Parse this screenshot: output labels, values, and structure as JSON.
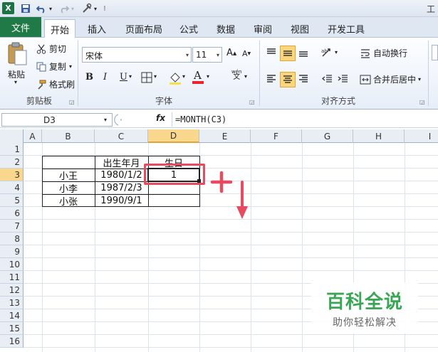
{
  "titlebar": {
    "app_icon_letter": "X",
    "title_fragment": "工"
  },
  "tabs": {
    "file": "文件",
    "items": [
      "开始",
      "插入",
      "页面布局",
      "公式",
      "数据",
      "审阅",
      "视图",
      "开发工具"
    ],
    "active_index": 0
  },
  "ribbon": {
    "clipboard": {
      "paste": "粘贴",
      "cut": "剪切",
      "copy": "复制",
      "format_painter": "格式刷",
      "group": "剪贴板"
    },
    "font": {
      "name": "宋体",
      "size": "11",
      "group": "字体",
      "phonetic_glyph": "wén"
    },
    "alignment": {
      "wrap": "自动换行",
      "merge": "合并后居中",
      "group": "对齐方式"
    }
  },
  "formula_bar": {
    "name_box": "D3",
    "formula": "=MONTH(C3)"
  },
  "sheet": {
    "columns": [
      "A",
      "B",
      "C",
      "D",
      "E",
      "F",
      "G",
      "H",
      "I"
    ],
    "selected_column": "D",
    "rows": [
      "1",
      "2",
      "3",
      "4",
      "5",
      "6",
      "7",
      "8",
      "9",
      "10",
      "11",
      "12",
      "13",
      "14",
      "15",
      "16"
    ],
    "selected_row": "3",
    "table": {
      "header": {
        "birth": "出生年月",
        "birthday": "生日"
      },
      "records": [
        {
          "name": "小王",
          "date": "1980/1/2",
          "month": "1"
        },
        {
          "name": "小李",
          "date": "1987/2/3",
          "month": ""
        },
        {
          "name": "小张",
          "date": "1990/9/1",
          "month": ""
        }
      ]
    }
  },
  "colors": {
    "excel_green": "#1f7a47",
    "selection_header": "#f9d88e",
    "annotation_red": "#e84a5f",
    "watermark_green": "#3aa655"
  },
  "watermark": {
    "title": "百科全说",
    "subtitle": "助你轻松解决"
  }
}
